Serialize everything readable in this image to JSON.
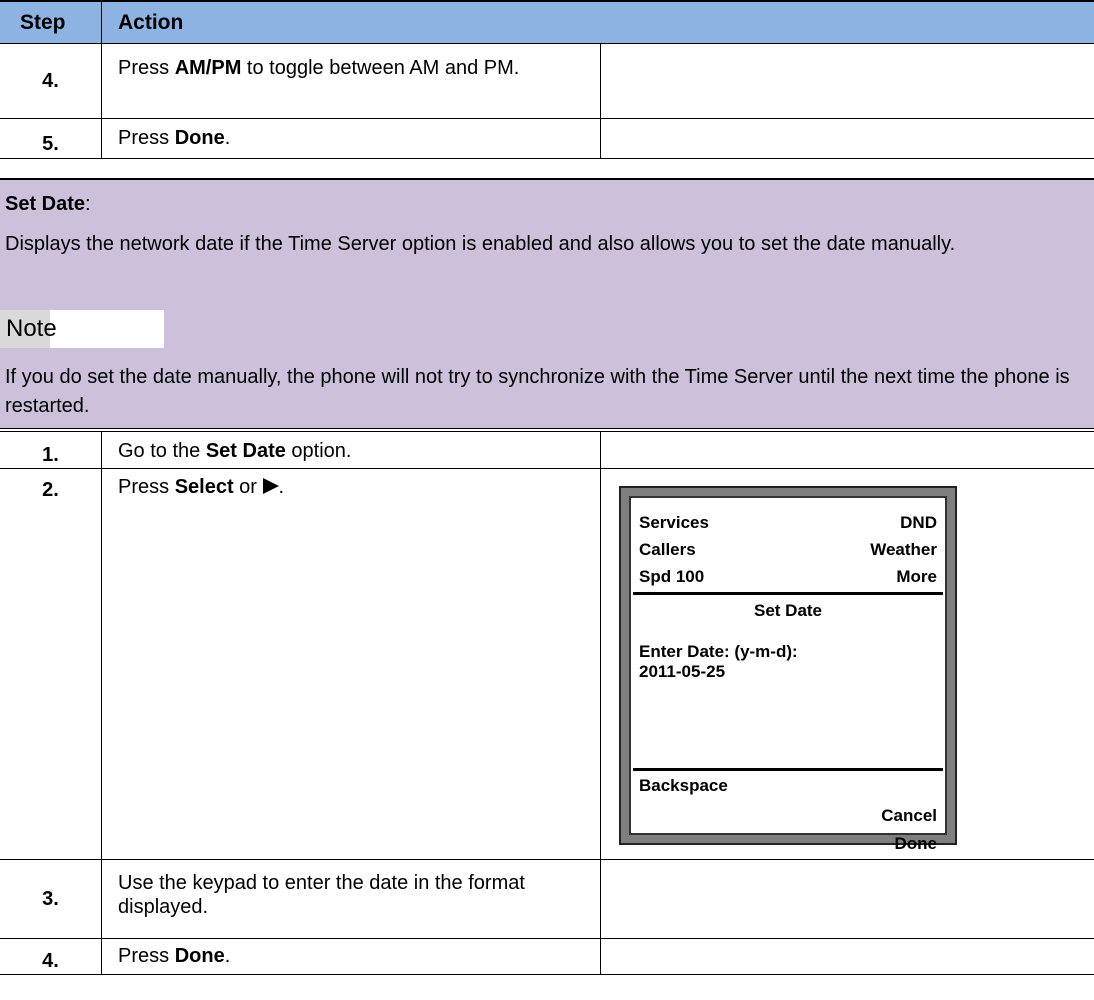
{
  "header": {
    "step": "Step",
    "action": "Action"
  },
  "rows_top": [
    {
      "step": "4.",
      "pre": "Press ",
      "bold": "AM/PM",
      "post": " to toggle between AM and PM."
    },
    {
      "step": "5.",
      "pre": "Press ",
      "bold": "Done",
      "post": "."
    }
  ],
  "set_date": {
    "title_bold": "Set Date",
    "title_post": ":",
    "description": "Displays the network date if the Time Server option is enabled and also allows you to set the date manually.",
    "note_label": "Note",
    "note_text": "If you do set the date manually, the phone will not try to synchronize with the Time Server until the next time the phone is restarted."
  },
  "rows_bottom": [
    {
      "step": "1.",
      "pre": "Go to the ",
      "bold": "Set Date",
      "post": " option."
    },
    {
      "step": "2.",
      "pre": "Press ",
      "bold": "Select",
      "post": " or "
    },
    {
      "step": "3.",
      "pre": "Use the keypad to enter the date in the format displayed.",
      "bold": "",
      "post": ""
    },
    {
      "step": "4.",
      "pre": "Press ",
      "bold": "Done",
      "post": "."
    }
  ],
  "phone_screen": {
    "soft_keys_top": [
      {
        "left": "Services",
        "right": "DND"
      },
      {
        "left": "Callers",
        "right": "Weather"
      },
      {
        "left": "Spd 100",
        "right": "More"
      }
    ],
    "screen_title": "Set Date",
    "prompt": "Enter Date:  (y-m-d):",
    "value": "2011-05-25",
    "soft_keys_bottom": [
      "Backspace",
      "Cancel",
      "Done"
    ]
  },
  "colors": {
    "header_bg": "#8db3e2",
    "band_bg": "#ccc0da",
    "phone_frame": "#7f7f7f"
  }
}
